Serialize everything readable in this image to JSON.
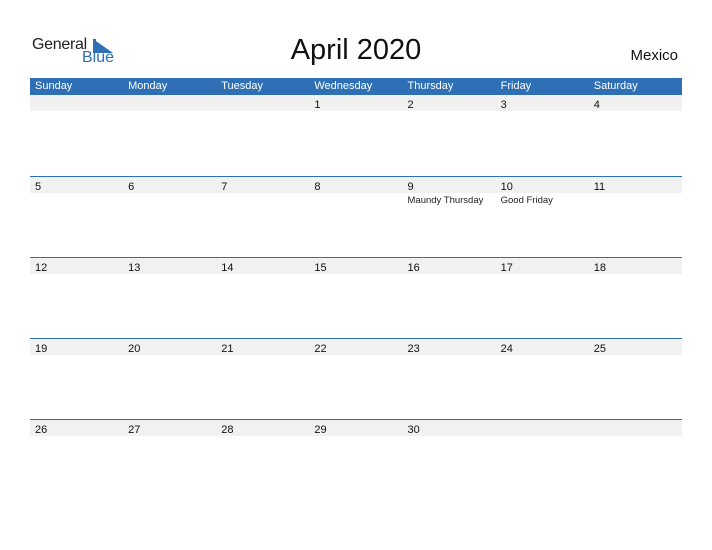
{
  "logo": {
    "general": "General",
    "blue": "Blue"
  },
  "header": {
    "title": "April 2020",
    "country": "Mexico"
  },
  "colors": {
    "accent": "#2e6fb5",
    "band": "#f1f1f1"
  },
  "weekdays": [
    "Sunday",
    "Monday",
    "Tuesday",
    "Wednesday",
    "Thursday",
    "Friday",
    "Saturday"
  ],
  "weeks": [
    {
      "days": [
        "",
        "",
        "",
        "1",
        "2",
        "3",
        "4"
      ],
      "holidays": [
        "",
        "",
        "",
        "",
        "",
        "",
        ""
      ]
    },
    {
      "days": [
        "5",
        "6",
        "7",
        "8",
        "9",
        "10",
        "11"
      ],
      "holidays": [
        "",
        "",
        "",
        "",
        "Maundy Thursday",
        "Good Friday",
        ""
      ]
    },
    {
      "days": [
        "12",
        "13",
        "14",
        "15",
        "16",
        "17",
        "18"
      ],
      "holidays": [
        "",
        "",
        "",
        "",
        "",
        "",
        ""
      ]
    },
    {
      "days": [
        "19",
        "20",
        "21",
        "22",
        "23",
        "24",
        "25"
      ],
      "holidays": [
        "",
        "",
        "",
        "",
        "",
        "",
        ""
      ]
    },
    {
      "days": [
        "26",
        "27",
        "28",
        "29",
        "30",
        "",
        ""
      ],
      "holidays": [
        "",
        "",
        "",
        "",
        "",
        "",
        ""
      ]
    }
  ]
}
